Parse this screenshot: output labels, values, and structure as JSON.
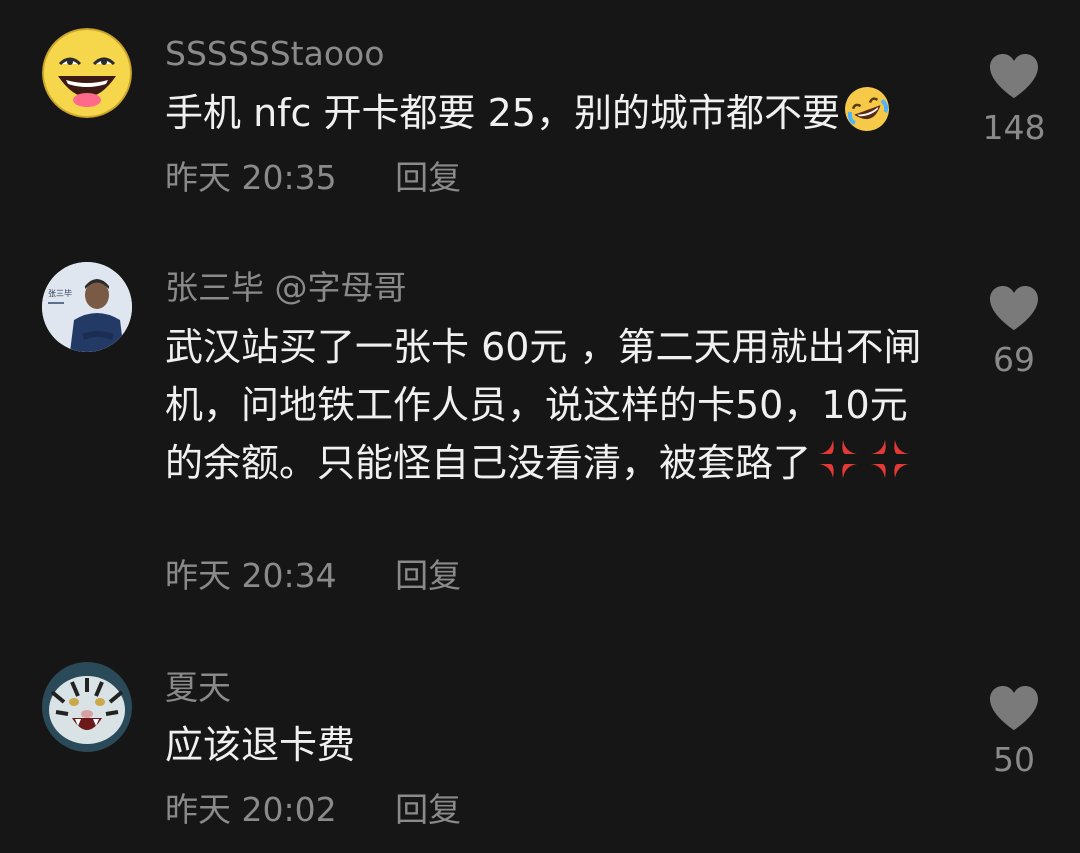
{
  "comments": [
    {
      "username": "SSSSSStaooo",
      "text": "手机 nfc 开卡都要 25，别的城市都不要",
      "emoji": "rolling-on-floor-laughing",
      "time": "昨天 20:35",
      "reply_label": "回复",
      "likes": "148"
    },
    {
      "username": "张三毕 @字母哥",
      "text": "武汉站买了一张卡 60元 ，第二天用就出不闸机，问地铁工作人员，说这样的卡50，10元的余额。只能怪自己没看清，被套路了",
      "emoji": "anger-symbol",
      "time": "昨天 20:34",
      "reply_label": "回复",
      "likes": "69"
    },
    {
      "username": "夏天",
      "text": "应该退卡费",
      "time": "昨天 20:02",
      "reply_label": "回复",
      "likes": "50"
    }
  ],
  "colors": {
    "background": "#161616",
    "muted_text": "#8a8a8a",
    "body_text": "#f0f0f0",
    "heart": "#7a7a7a",
    "anger": "#e53935"
  },
  "avatar_labels": {
    "second": "张三毕"
  }
}
